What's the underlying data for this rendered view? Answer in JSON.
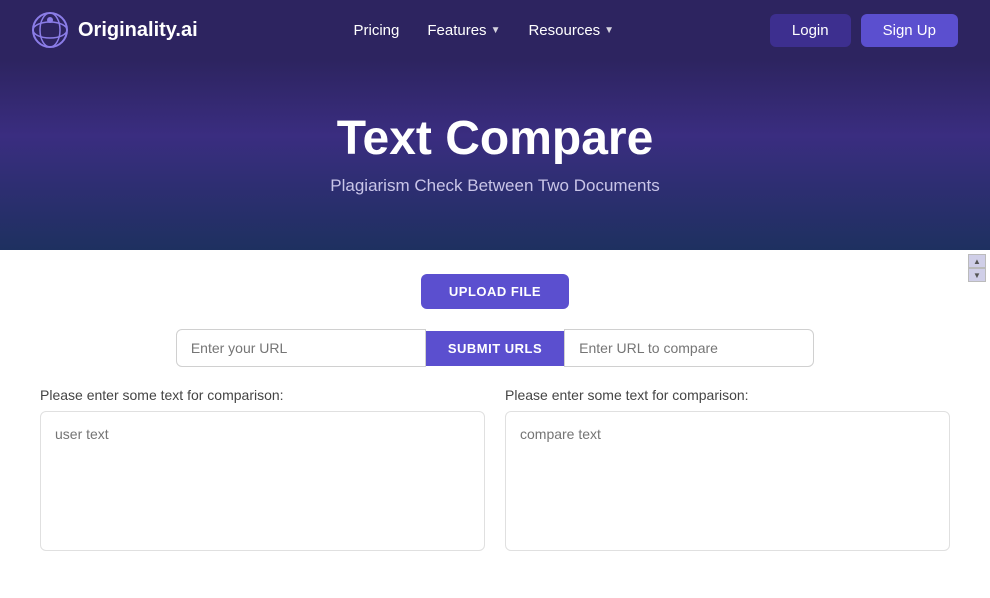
{
  "nav": {
    "logo_text": "Originality.ai",
    "links": [
      {
        "label": "Pricing",
        "has_chevron": false
      },
      {
        "label": "Features",
        "has_chevron": true
      },
      {
        "label": "Resources",
        "has_chevron": true
      }
    ],
    "login_label": "Login",
    "signup_label": "Sign Up"
  },
  "hero": {
    "title": "Text Compare",
    "subtitle": "Plagiarism Check Between Two Documents"
  },
  "main": {
    "upload_label": "UPLOAD FILE",
    "url_input_placeholder": "Enter your URL",
    "submit_urls_label": "SUBMIT URLS",
    "compare_url_placeholder": "Enter URL to compare",
    "left_label": "Please enter some text for comparison:",
    "right_label": "Please enter some text for comparison:",
    "left_placeholder": "user text",
    "right_placeholder": "compare text"
  }
}
